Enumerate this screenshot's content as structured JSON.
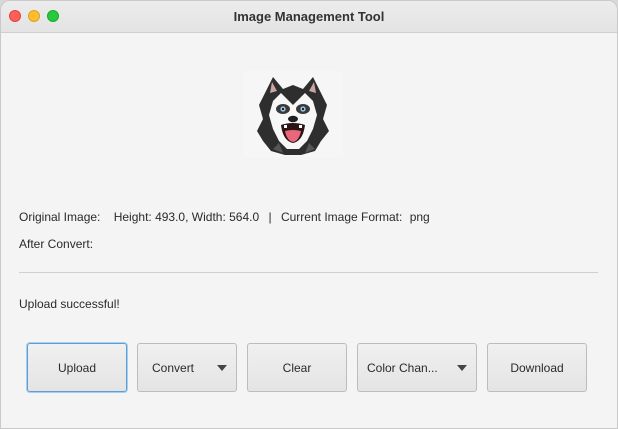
{
  "window": {
    "title": "Image Management Tool"
  },
  "preview": {
    "alt": "husky-image"
  },
  "info": {
    "original_label": "Original Image:",
    "dimensions": "Height: 493.0, Width: 564.0",
    "separator": "|",
    "format_label": "Current Image Format:",
    "format_value": "png",
    "after_label": "After Convert:"
  },
  "status": {
    "message": "Upload successful!"
  },
  "buttons": {
    "upload": "Upload",
    "convert": "Convert",
    "clear": "Clear",
    "color_change": "Color Chan...",
    "download": "Download"
  }
}
